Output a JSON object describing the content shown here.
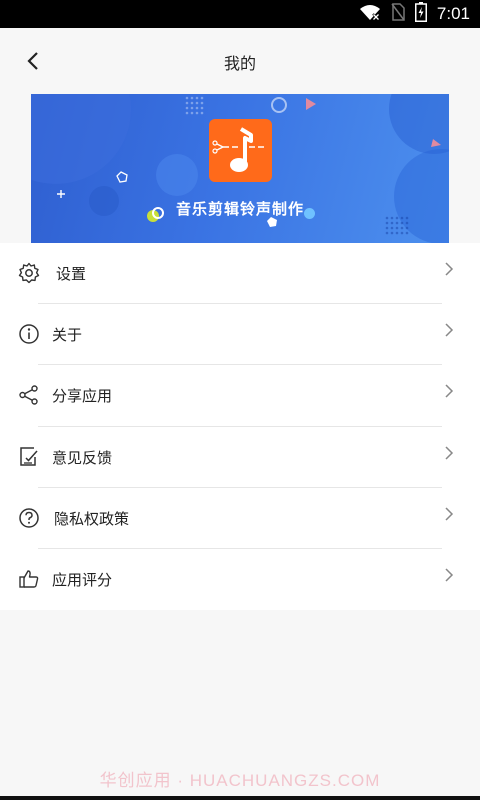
{
  "status_bar": {
    "time": "7:01"
  },
  "header": {
    "title": "我的"
  },
  "banner": {
    "title": "音乐剪辑铃声制作"
  },
  "menu": {
    "items": [
      {
        "label": "设置",
        "icon": "gear-icon"
      },
      {
        "label": "关于",
        "icon": "info-icon"
      },
      {
        "label": "分享应用",
        "icon": "share-icon"
      },
      {
        "label": "意见反馈",
        "icon": "feedback-icon"
      },
      {
        "label": "隐私权政策",
        "icon": "help-circle-icon"
      },
      {
        "label": "应用评分",
        "icon": "thumbs-up-icon"
      }
    ]
  },
  "watermark": "华创应用 · HUACHUANGZS.COM",
  "colors": {
    "banner_accent": "#3a73e3",
    "logo_orange": "#ff6a1a",
    "watermark": "#f2c4cc"
  }
}
